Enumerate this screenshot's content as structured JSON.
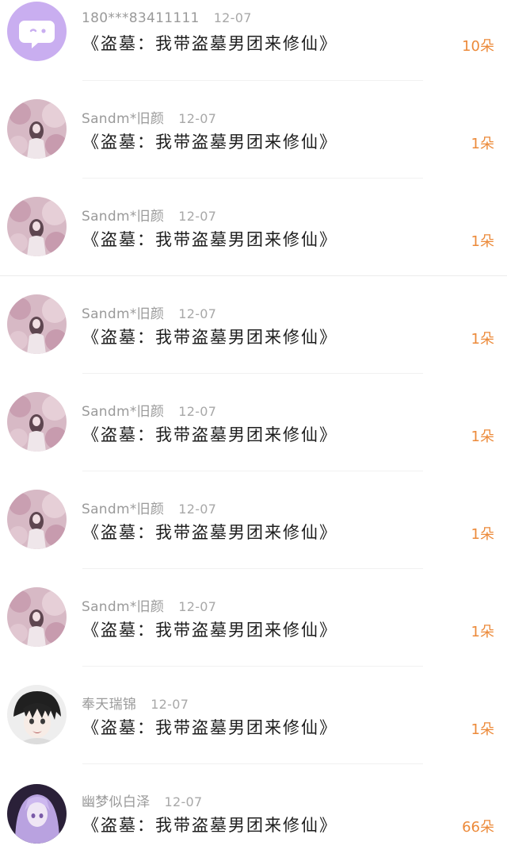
{
  "gift_list": {
    "items": [
      {
        "user": "180***83411111",
        "date": "12-07",
        "title": "《盗墓：我带盗墓男团来修仙》",
        "count": "10朵",
        "avatar": "chat-bubble"
      },
      {
        "user": "Sandm*旧颜",
        "date": "12-07",
        "title": "《盗墓：我带盗墓男团来修仙》",
        "count": "1朵",
        "avatar": "girl-pink"
      },
      {
        "user": "Sandm*旧颜",
        "date": "12-07",
        "title": "《盗墓：我带盗墓男团来修仙》",
        "count": "1朵",
        "avatar": "girl-pink"
      },
      {
        "user": "Sandm*旧颜",
        "date": "12-07",
        "title": "《盗墓：我带盗墓男团来修仙》",
        "count": "1朵",
        "avatar": "girl-pink"
      },
      {
        "user": "Sandm*旧颜",
        "date": "12-07",
        "title": "《盗墓：我带盗墓男团来修仙》",
        "count": "1朵",
        "avatar": "girl-pink"
      },
      {
        "user": "Sandm*旧颜",
        "date": "12-07",
        "title": "《盗墓：我带盗墓男团来修仙》",
        "count": "1朵",
        "avatar": "girl-pink"
      },
      {
        "user": "Sandm*旧颜",
        "date": "12-07",
        "title": "《盗墓：我带盗墓男团来修仙》",
        "count": "1朵",
        "avatar": "girl-pink"
      },
      {
        "user": "奉天瑞锦",
        "date": "12-07",
        "title": "《盗墓：我带盗墓男团来修仙》",
        "count": "1朵",
        "avatar": "anime-boy"
      },
      {
        "user": "幽梦似白泽",
        "date": "12-07",
        "title": "《盗墓：我带盗墓男团来修仙》",
        "count": "66朵",
        "avatar": "anime-purple"
      }
    ]
  },
  "colors": {
    "count_accent": "#ec8a3a",
    "title_text": "#1d1d1d",
    "meta_text": "#9a9a9a",
    "avatar_purple": "#c9aef0"
  }
}
